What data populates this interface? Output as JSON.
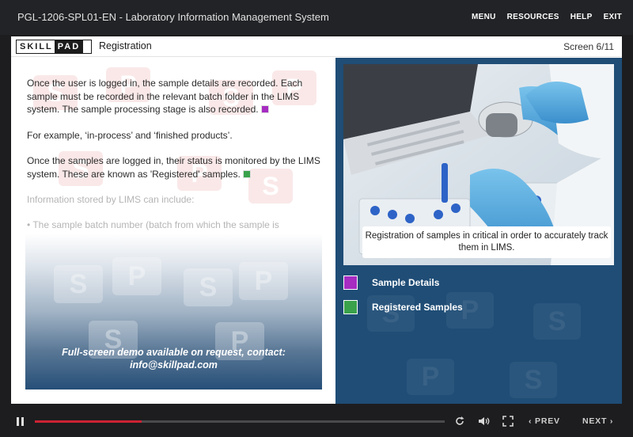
{
  "app": {
    "title": "PGL-1206-SPL01-EN - Laboratory Information Management System",
    "menu": [
      "MENU",
      "RESOURCES",
      "HELP",
      "EXIT"
    ]
  },
  "header": {
    "logo_skill": "SKILL",
    "logo_pad": "PAD",
    "section_title": "Registration",
    "screen_counter": "Screen 6/11"
  },
  "content": {
    "para1": "Once the user is logged in, the sample details are recorded. Each sample must be recorded in the relevant batch folder in the LIMS system. The sample processing stage is also recorded.",
    "para2": "For example, ‘in-process’ and ‘finished products’.",
    "para3": "Once the samples are logged in, their status is monitored by the LIMS system. These are known as 'Registered' samples.",
    "para4": "Information stored by LIMS can include:",
    "bullet1": "The sample batch number (batch from which the sample is"
  },
  "demo": {
    "line1": "Full-screen demo available on request, contact:",
    "line2": "info@skillpad.com"
  },
  "media": {
    "caption": "Registration of samples in critical in order to accurately track them in LIMS."
  },
  "legend": [
    {
      "label": "Sample Details",
      "color": "#a62cc2"
    },
    {
      "label": "Registered Samples",
      "color": "#3aa24b"
    }
  ],
  "player": {
    "progress": 0.26,
    "prev_label": "PREV",
    "next_label": "NEXT"
  },
  "colors": {
    "accent_purple": "#a62cc2",
    "accent_green": "#3aa24b",
    "panel_blue": "#1f4d76",
    "progress_red": "#cc2233"
  }
}
